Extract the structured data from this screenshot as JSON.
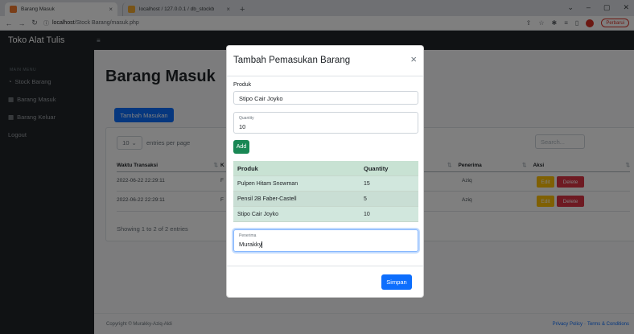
{
  "browser": {
    "tabs": [
      {
        "title": "Barang Masuk",
        "favicon_color": "#f47c30",
        "active": true
      },
      {
        "title": "localhost / 127.0.0.1 / db_stockb",
        "favicon_color": "#f0a830",
        "active": false
      }
    ],
    "close_glyph": "×",
    "new_tab_glyph": "+",
    "url_host": "localhost",
    "url_path": "/Stock Barang/masuk.php",
    "update_label": "Perbarui"
  },
  "navbar": {
    "brand": "Toko Alat Tulis"
  },
  "sidebar": {
    "heading": "MAIN MENU",
    "items": [
      {
        "label": "Stock Barang",
        "icon": "gauge-icon"
      },
      {
        "label": "Barang Masuk",
        "icon": "table-icon"
      },
      {
        "label": "Barang Keluar",
        "icon": "table-icon"
      },
      {
        "label": "Logout",
        "icon": "none"
      }
    ]
  },
  "page": {
    "title": "Barang Masuk",
    "add_button": "Tambah Masukan",
    "entries_value": "10",
    "entries_label": "entries per page",
    "search_placeholder": "Search...",
    "columns": [
      "Waktu Transaksi",
      "K",
      "Penerima",
      "Aksi"
    ],
    "rows": [
      {
        "time": "2022-06-22 22:29:11",
        "col2": "F",
        "penerima": "Aziq",
        "edit": "Edit",
        "delete": "Delete"
      },
      {
        "time": "2022-06-22 22:29:11",
        "col2": "F",
        "penerima": "Aziq",
        "edit": "Edit",
        "delete": "Delete"
      }
    ],
    "showing": "Showing 1 to 2 of 2 entries",
    "copyright": "Copyright © Murakky-Aziq-Aldi",
    "footer_links": [
      "Privacy Policy",
      "·",
      "Terms & Conditions"
    ]
  },
  "modal": {
    "title": "Tambah Pemasukan Barang",
    "close_glyph": "×",
    "produk_label": "Produk",
    "produk_value": "Stipo Cair Joyko",
    "quantity_label": "Quantity",
    "quantity_value": "10",
    "add_button": "Add",
    "table": {
      "headers": [
        "Produk",
        "Quantity"
      ],
      "rows": [
        {
          "produk": "Pulpen Hitam Snowman",
          "qty": "15"
        },
        {
          "produk": "Pensil 2B Faber-Castell",
          "qty": "5"
        },
        {
          "produk": "Stipo Cair Joyko",
          "qty": "10"
        }
      ]
    },
    "penerima_label": "Penerima",
    "penerima_value": "Murakky",
    "save_button": "Simpan"
  },
  "colors": {
    "primary": "#0d6efd",
    "success": "#198754",
    "warning": "#ffc107",
    "danger": "#dc3545",
    "dark": "#212529"
  }
}
